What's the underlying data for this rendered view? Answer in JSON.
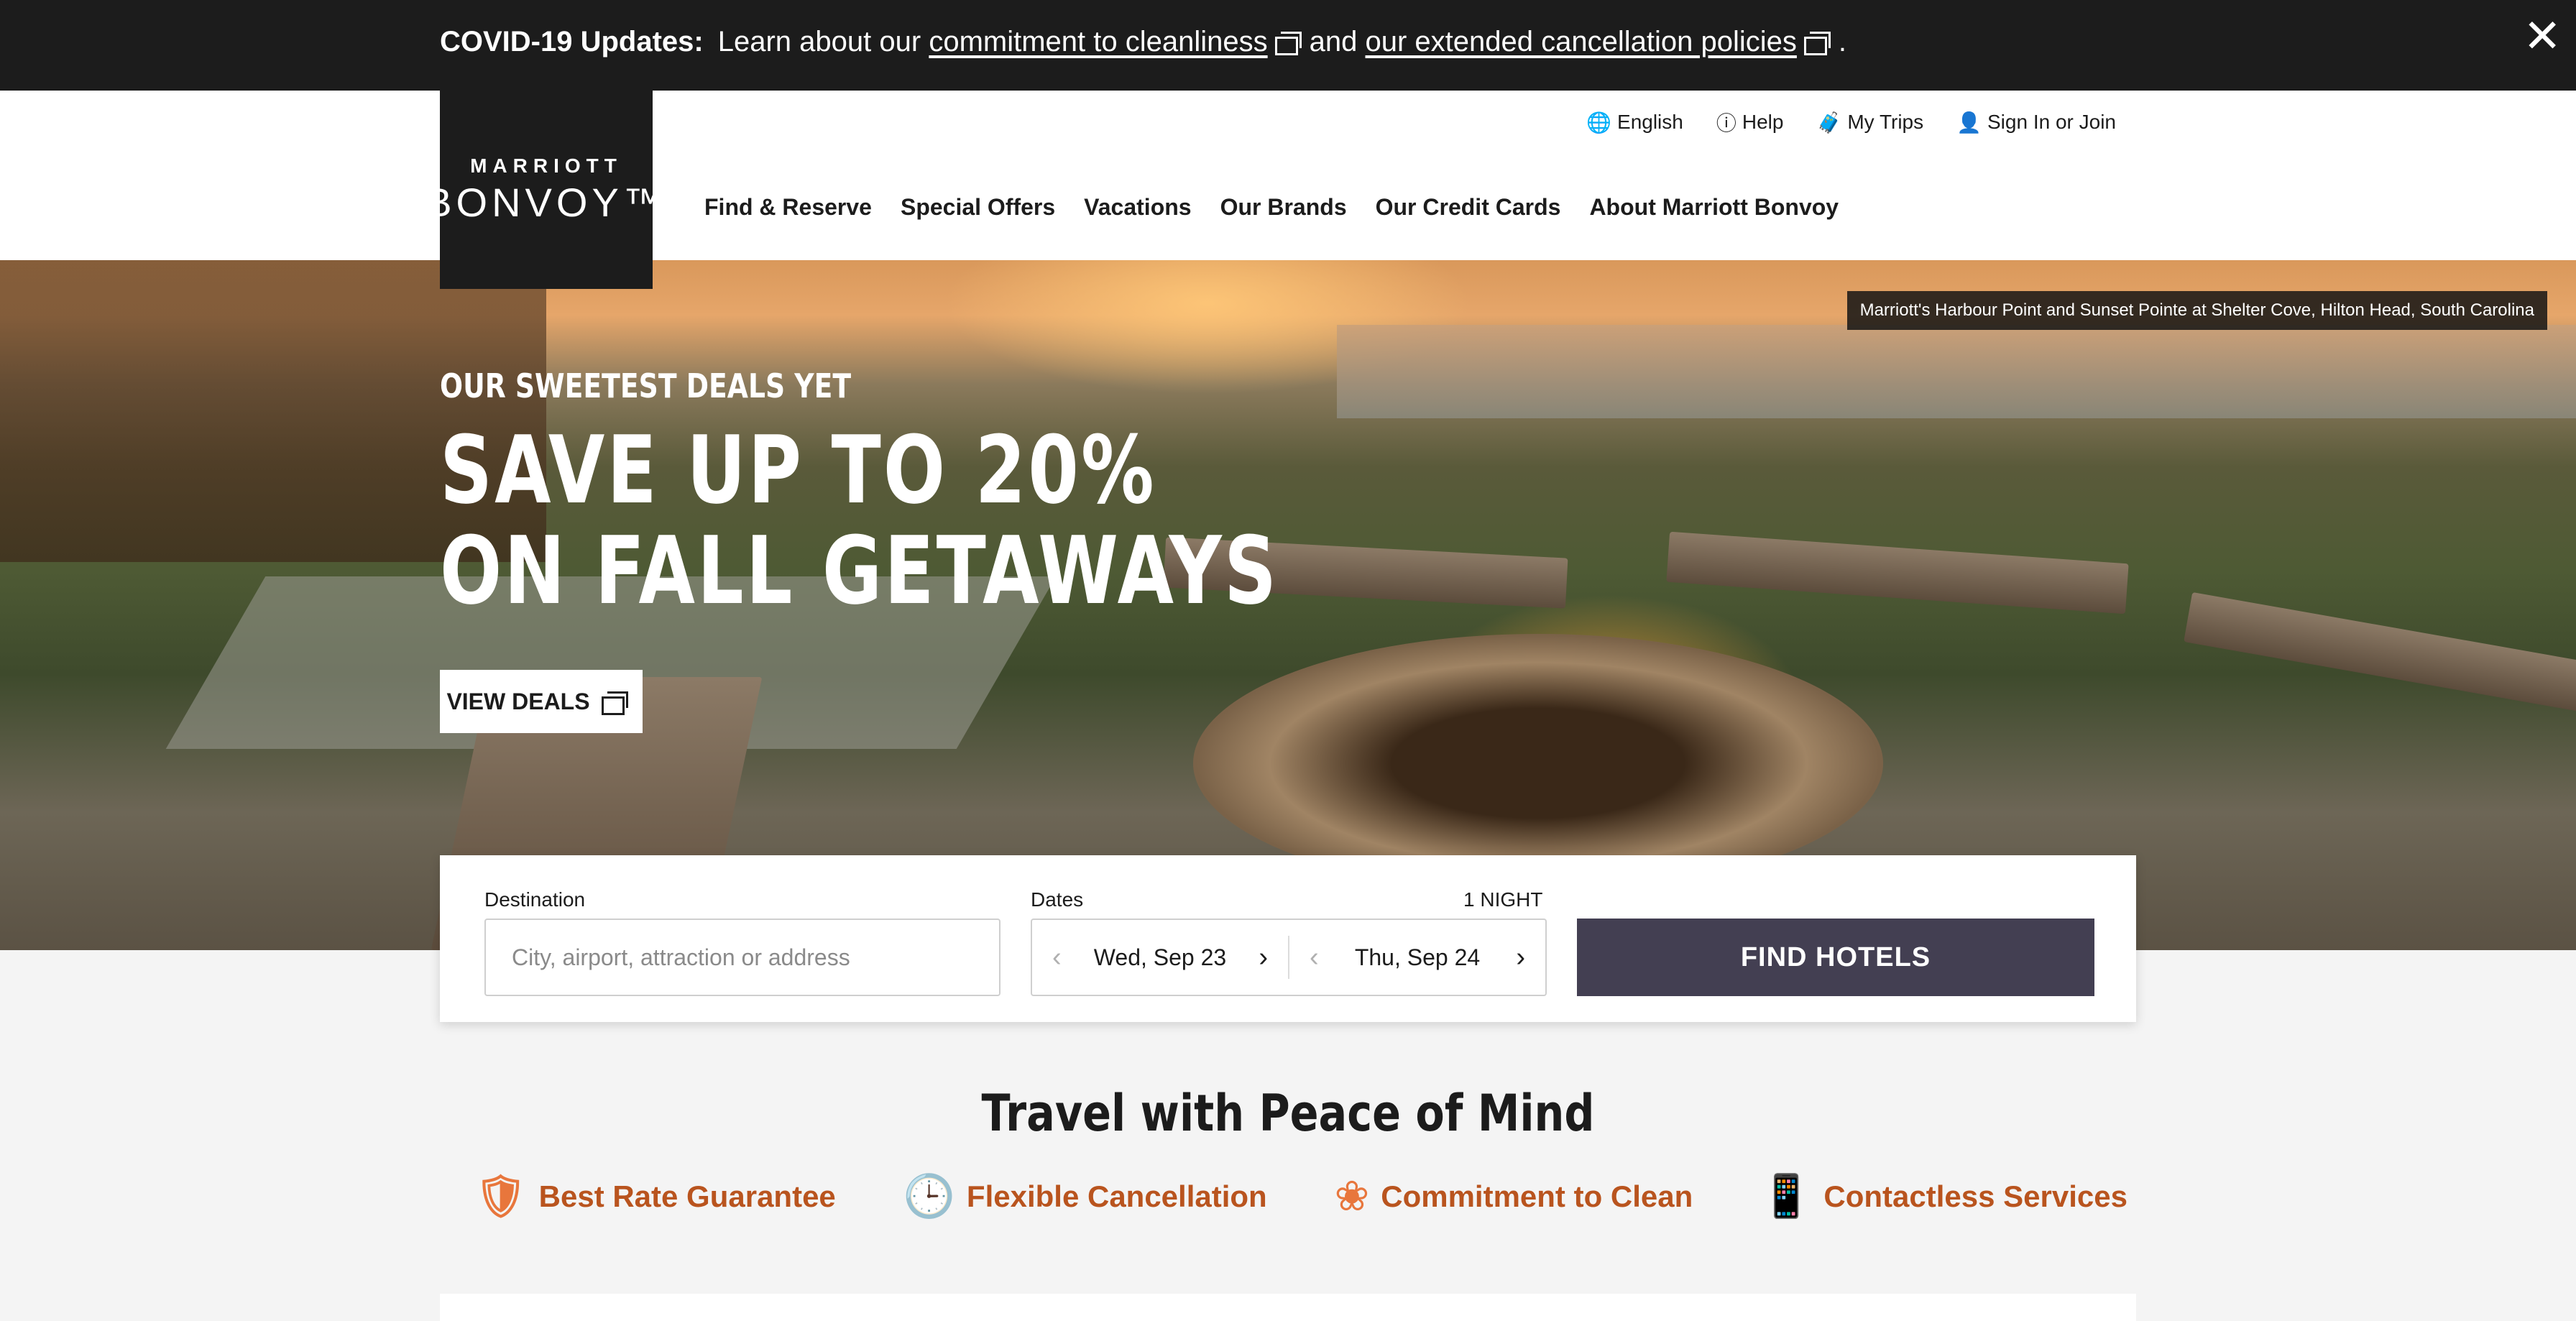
{
  "covid": {
    "lead": "COVID-19 Updates:",
    "text1": "Learn about our",
    "link1": "commitment to cleanliness",
    "text2": "and",
    "link2": "our extended cancellation policies",
    "text3": ".",
    "close": "✕"
  },
  "logo": {
    "line1": "MARRIOTT",
    "line2": "BONVOY™"
  },
  "utility": [
    {
      "icon": "globe-icon",
      "glyph": "🌐",
      "label": "English"
    },
    {
      "icon": "help-icon",
      "glyph": "ⓘ",
      "label": "Help"
    },
    {
      "icon": "suitcase-icon",
      "glyph": "🧳",
      "label": "My Trips"
    },
    {
      "icon": "user-icon",
      "glyph": "👤",
      "label": "Sign In or Join"
    }
  ],
  "nav": [
    "Find & Reserve",
    "Special Offers",
    "Vacations",
    "Our Brands",
    "Our Credit Cards",
    "About Marriott Bonvoy"
  ],
  "hero": {
    "caption": "Marriott's Harbour Point and Sunset Pointe at Shelter Cove, Hilton Head, South Carolina",
    "eyebrow": "OUR SWEETEST DEALS YET",
    "title1": "SAVE UP TO 20%",
    "title2": "ON FALL GETAWAYS",
    "cta": "VIEW DEALS"
  },
  "search": {
    "destination_label": "Destination",
    "destination_placeholder": "City, airport, attraction or address",
    "dates_label": "Dates",
    "nights": "1 NIGHT",
    "check_in": "Wed, Sep 23",
    "check_out": "Thu, Sep 24",
    "find": "FIND HOTELS"
  },
  "peace": {
    "title": "Travel with Peace of Mind",
    "features": [
      {
        "icon": "shield-tag-icon",
        "glyph": "🛡",
        "label": "Best Rate Guarantee"
      },
      {
        "icon": "clock-icon",
        "glyph": "🕒",
        "label": "Flexible Cancellation"
      },
      {
        "icon": "lotus-icon",
        "glyph": "❀",
        "label": "Commitment to Clean"
      },
      {
        "icon": "phone-icon",
        "glyph": "📱",
        "label": "Contactless Services"
      }
    ]
  },
  "colors": {
    "accent": "#b9541e",
    "button": "#433f52",
    "banner": "#1c1c1c"
  }
}
